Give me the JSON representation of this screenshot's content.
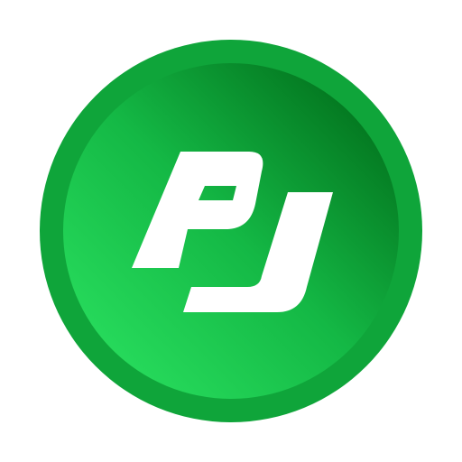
{
  "logo": {
    "text": "PJ",
    "colors": {
      "background": "#ffffff",
      "ring": "#0fa53a",
      "face_light": "#27db5c",
      "face_mid": "#14b845",
      "face_dark": "#03761f",
      "glyph": "#ffffff"
    }
  }
}
